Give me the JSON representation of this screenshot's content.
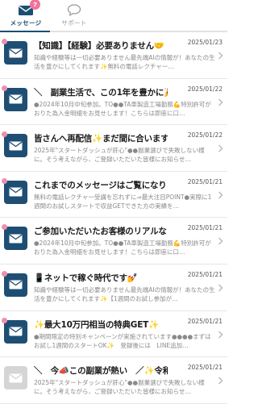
{
  "tabs": [
    {
      "label": "メッセージ",
      "badge": "7",
      "icon": "envelope-icon"
    },
    {
      "label": "サポート",
      "icon": "chat-bubble-icon"
    }
  ],
  "colors": {
    "accent": "#1a4f73",
    "unread_dot": "#ee8fb0",
    "badge": "#f0739a"
  },
  "messages": [
    {
      "title": "【知識】【経験】必要ありません🤝",
      "date": "2025/01/23",
      "preview": "知識や経験等は一切必要ありません最先端AIの情報が！あなたの生活を豊かにしてくれます✨無料の電話レクチャー…",
      "unread": true
    },
    {
      "title": "＼　副業生活で、この1年を豊かに🎉",
      "date": "2025/01/22",
      "preview": "●2024年10月中旬参加。TO●●TA車製造工場勤務💪特別許可がおりた為入金明細をお見せします！こちらは即座に口…",
      "unread": true
    },
    {
      "title": "皆さんへ再配信✨まだ間に合います！",
      "date": "2025/01/22",
      "preview": "2025年\"スタートダッシュが肝心\"●●副業選びで失敗しない様に。そう考えながら、ご登録いただいた皆様にお知らせ…",
      "unread": true
    },
    {
      "title": "これまでのメッセージはご覧になりま…",
      "date": "2025/01/21",
      "preview": "無料の電話レクチャー受講を忘れずに⇒最大注目POINT●実際に1週間のお試しスタートで収益GETできた方の実績を…",
      "unread": true
    },
    {
      "title": "ご参加いただいたお客様のリアルな💰",
      "date": "2025/01/21",
      "preview": "●2024年10月中旬参加。TO●●TA車製造工場勤務💪特別許可がおりた為入金明細をお見せします！こちらは即座に口…",
      "unread": true
    },
    {
      "title": "📱ネットで稼ぐ時代です💅",
      "date": "2025/01/21",
      "preview": "知識や経験等は一切必要ありません最先端AIの情報が！あなたの生活を豊かにしてくれます✨【1週間のお試し参加が…",
      "unread": true
    },
    {
      "title": "✨最大10万円相当の特典GET✨",
      "date": "2025/01/21",
      "preview": "●期間限定の特別キャンペーンが実施されています●●●●まずはお試し1週間のスタートOK✨　登録後には　LINE追加…",
      "unread": true
    },
    {
      "title": "＼　今📣この副業が熱い　／✨令和…",
      "date": "2025/01/21",
      "preview": "2025年\"スタートダッシュが肝心\"●●副業選びで失敗しない様に。そう考えながら、ご登録いただいた皆様にお知らせ…",
      "unread": false
    }
  ]
}
